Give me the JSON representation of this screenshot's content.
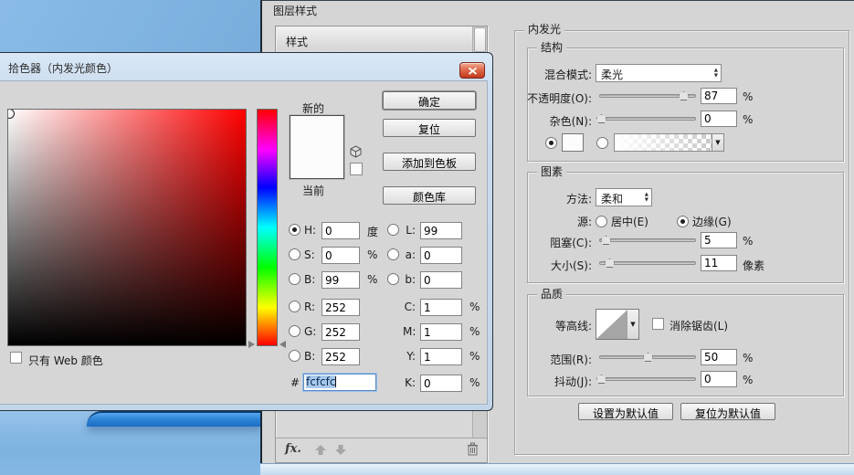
{
  "layer_style": {
    "title": "图层样式",
    "styles_header": "样式",
    "fx_label": "fx."
  },
  "picker": {
    "title": "拾色器（内发光颜色）",
    "new_label": "新的",
    "current_label": "当前",
    "ok": "确定",
    "reset": "复位",
    "add_to_swatches": "添加到色板",
    "color_libraries": "颜色库",
    "hsb": {
      "h": {
        "label": "H:",
        "value": "0",
        "unit": "度"
      },
      "s": {
        "label": "S:",
        "value": "0",
        "unit": "%"
      },
      "b": {
        "label": "B:",
        "value": "99",
        "unit": "%"
      }
    },
    "rgb": {
      "r": {
        "label": "R:",
        "value": "252"
      },
      "g": {
        "label": "G:",
        "value": "252"
      },
      "b": {
        "label": "B:",
        "value": "252"
      }
    },
    "lab": {
      "l": {
        "label": "L:",
        "value": "99"
      },
      "a": {
        "label": "a:",
        "value": "0"
      },
      "b": {
        "label": "b:",
        "value": "0"
      }
    },
    "cmyk": {
      "c": {
        "label": "C:",
        "value": "1",
        "unit": "%"
      },
      "m": {
        "label": "M:",
        "value": "1",
        "unit": "%"
      },
      "y": {
        "label": "Y:",
        "value": "1",
        "unit": "%"
      },
      "k": {
        "label": "K:",
        "value": "0",
        "unit": "%"
      }
    },
    "hex": {
      "label": "#",
      "value": "fcfcfc"
    },
    "web_only_label": "只有 Web 颜色",
    "selected_color": "#fcfcfc"
  },
  "inner_glow": {
    "title": "内发光",
    "structure": {
      "title": "结构",
      "blend_mode_label": "混合模式:",
      "blend_mode_value": "柔光",
      "opacity_label": "不透明度(O):",
      "opacity_value": "87",
      "opacity_unit": "%",
      "noise_label": "杂色(N):",
      "noise_value": "0",
      "noise_unit": "%"
    },
    "elements": {
      "title": "图素",
      "technique_label": "方法:",
      "technique_value": "柔和",
      "source_label": "源:",
      "source_center_label": "居中(E)",
      "source_edge_label": "边缘(G)",
      "choke_label": "阻塞(C):",
      "choke_value": "5",
      "choke_unit": "%",
      "size_label": "大小(S):",
      "size_value": "11",
      "size_unit": "像素"
    },
    "quality": {
      "title": "品质",
      "contour_label": "等高线:",
      "antialias_label": "消除锯齿(L)",
      "range_label": "范围(R):",
      "range_value": "50",
      "range_unit": "%",
      "jitter_label": "抖动(J):",
      "jitter_value": "0",
      "jitter_unit": "%"
    },
    "make_default": "设置为默认值",
    "reset_default": "复位为默认值"
  },
  "colors": {
    "desktop_blue": "#7db2e0",
    "close_button_red": "#c23a1e",
    "hex_selection": "#a8c9ee",
    "hue_current": "#ff0000"
  }
}
